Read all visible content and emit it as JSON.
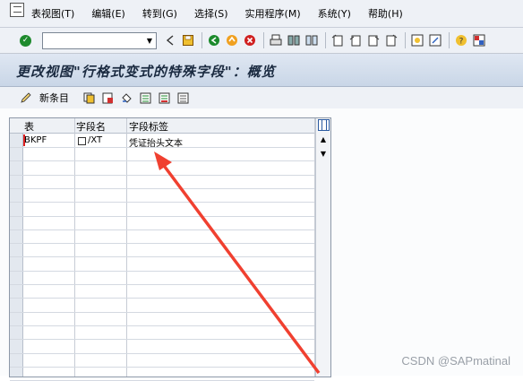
{
  "menubar": {
    "items": [
      "表视图(T)",
      "编辑(E)",
      "转到(G)",
      "选择(S)",
      "实用程序(M)",
      "系统(Y)",
      "帮助(H)"
    ]
  },
  "toolbar": {
    "command_value": "",
    "icons": [
      "enter-icon",
      "command-dropdown-icon",
      "back-arrow-icon",
      "save-icon",
      "back-icon",
      "exit-icon",
      "cancel-icon",
      "print-icon",
      "find-icon",
      "find-next-icon",
      "first-page-icon",
      "previous-page-icon",
      "next-page-icon",
      "last-page-icon",
      "create-session-icon",
      "shortcut-icon",
      "help-icon",
      "layout-menu-icon"
    ]
  },
  "title": "更改视图\"行格式变式的特殊字段\"：概览",
  "app_toolbar": {
    "new_entries_label": "新条目"
  },
  "table": {
    "headers": [
      "表",
      "字段名",
      "字段标签"
    ],
    "rows": [
      {
        "table": "BKPF",
        "field": "/XT",
        "label": "凭证抬头文本"
      }
    ]
  },
  "watermark": "CSDN @SAPmatinal",
  "colors": {
    "annotation_arrow": "#f04030",
    "title_text": "#1a2a40"
  }
}
